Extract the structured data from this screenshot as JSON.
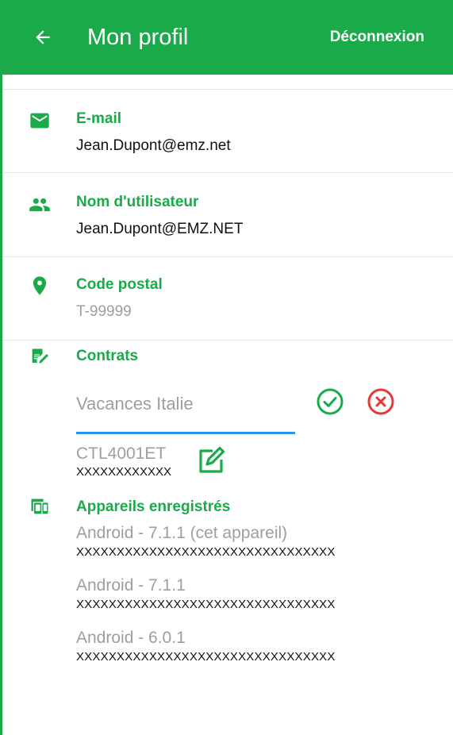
{
  "header": {
    "title": "Mon profil",
    "logout_label": "Déconnexion",
    "back_icon": "arrow-left-icon"
  },
  "profile": {
    "email": {
      "label": "E-mail",
      "value": "Jean.Dupont@emz.net",
      "icon": "mail-icon"
    },
    "username": {
      "label": "Nom d'utilisateur",
      "value": "Jean.Dupont@EMZ.NET",
      "icon": "people-icon"
    },
    "postal": {
      "label": "Code postal",
      "value": "T-99999",
      "icon": "location-pin-icon"
    }
  },
  "contracts": {
    "label": "Contrats",
    "icon": "edit-document-icon",
    "input_value": "Vacances Italie",
    "confirm_icon": "check-circle-icon",
    "cancel_icon": "cancel-circle-icon",
    "items": [
      {
        "code": "CTL4001ET",
        "subtitle": "XXXXXXXXXXXX",
        "edit_icon": "pencil-edit-icon"
      }
    ]
  },
  "devices": {
    "label": "Appareils enregistrés",
    "icon": "devices-icon",
    "items": [
      {
        "name": "Android - 7.1.1 (cet appareil)",
        "id": "XXXXXXXXXXXXXXXXXXXXXXXXXXXXXXXX"
      },
      {
        "name": "Android - 7.1.1",
        "id": "XXXXXXXXXXXXXXXXXXXXXXXXXXXXXXXX"
      },
      {
        "name": "Android - 6.0.1",
        "id": "XXXXXXXXXXXXXXXXXXXXXXXXXXXXXXXX"
      }
    ]
  },
  "colors": {
    "primary": "#1aaa4a",
    "accent_input": "#2196f3",
    "cancel": "#e53935",
    "muted_text": "#9e9e9e"
  }
}
